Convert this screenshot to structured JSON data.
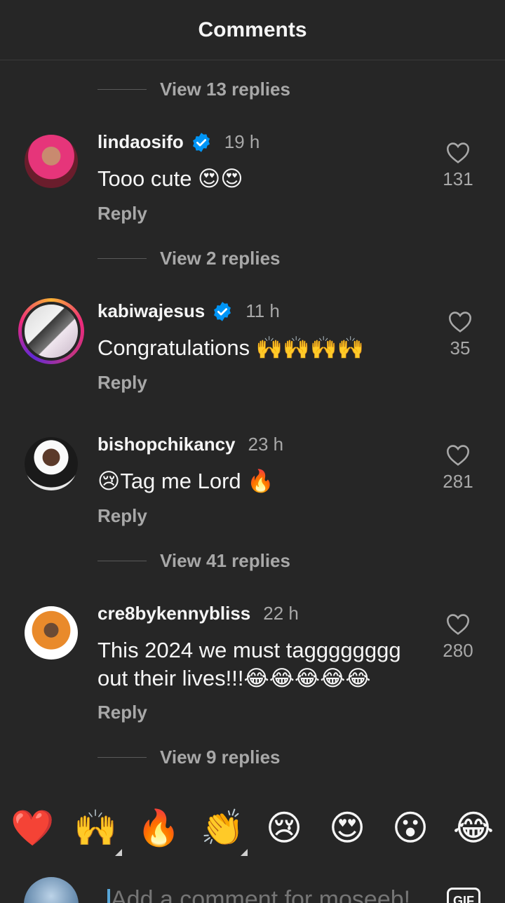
{
  "header": {
    "title": "Comments"
  },
  "threads": {
    "r0": "View 13 replies",
    "r1": "View 2 replies",
    "r2": "View 41 replies",
    "r3": "View 9 replies"
  },
  "comments": [
    {
      "username": "lindaosifo",
      "verified": true,
      "time": "19 h",
      "text": "Tooo cute 😍😍",
      "reply_label": "Reply",
      "likes": "131"
    },
    {
      "username": "kabiwajesus",
      "verified": true,
      "time": "11 h",
      "text": "Congratulations 🙌🙌🙌🙌",
      "reply_label": "Reply",
      "likes": "35",
      "story_ring": true
    },
    {
      "username": "bishopchikancy",
      "verified": false,
      "time": "23 h",
      "text": "😢Tag me Lord 🔥",
      "reply_label": "Reply",
      "likes": "281"
    },
    {
      "username": "cre8bykennybliss",
      "verified": false,
      "time": "22 h",
      "text": "This 2024 we must tagggggggg out their lives!!!😂😂😂😂😂",
      "reply_label": "Reply",
      "likes": "280"
    }
  ],
  "emoji_bar": [
    "❤️",
    "🙌",
    "🔥",
    "👏",
    "😢",
    "😍",
    "😮",
    "😂"
  ],
  "composer": {
    "placeholder": "Add a comment for moseeb!",
    "gif_label": "GIF"
  },
  "colors": {
    "background": "#262626",
    "verified": "#0095f6",
    "muted": "#a8a8a8"
  },
  "icons": {
    "verified": "verified-badge-icon",
    "like": "heart-outline-icon"
  }
}
